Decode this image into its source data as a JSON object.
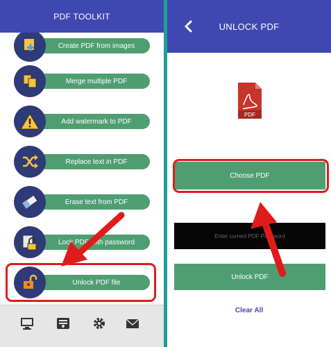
{
  "left": {
    "title": "PDF TOOLKIT",
    "items": [
      {
        "label": "Create PDF from images",
        "icon": "images-add-icon"
      },
      {
        "label": "Merge multiple PDF",
        "icon": "merge-files-icon"
      },
      {
        "label": "Add watermark to PDF",
        "icon": "warning-icon"
      },
      {
        "label": "Replace text in PDF",
        "icon": "shuffle-icon"
      },
      {
        "label": "Erase text from PDF",
        "icon": "eraser-icon"
      },
      {
        "label": "Lock PDF with password",
        "icon": "lock-icon"
      },
      {
        "label": "Unlock PDF file",
        "icon": "unlock-icon"
      }
    ],
    "bottom_nav": [
      "monitor-icon",
      "document-icon",
      "gear-icon",
      "mail-icon"
    ]
  },
  "right": {
    "title": "UNLOCK PDF",
    "pdf_badge": "PDF",
    "choose_label": "Choose PDF",
    "password_placeholder": "Enter current PDF Password",
    "unlock_label": "Unlock PDF",
    "clear_label": "Clear All"
  },
  "colors": {
    "appbar": "#3f48b0",
    "button": "#4f9e72",
    "circle": "#2f3a78",
    "highlight": "#e11b1b",
    "divider": "#1f9e9a"
  }
}
